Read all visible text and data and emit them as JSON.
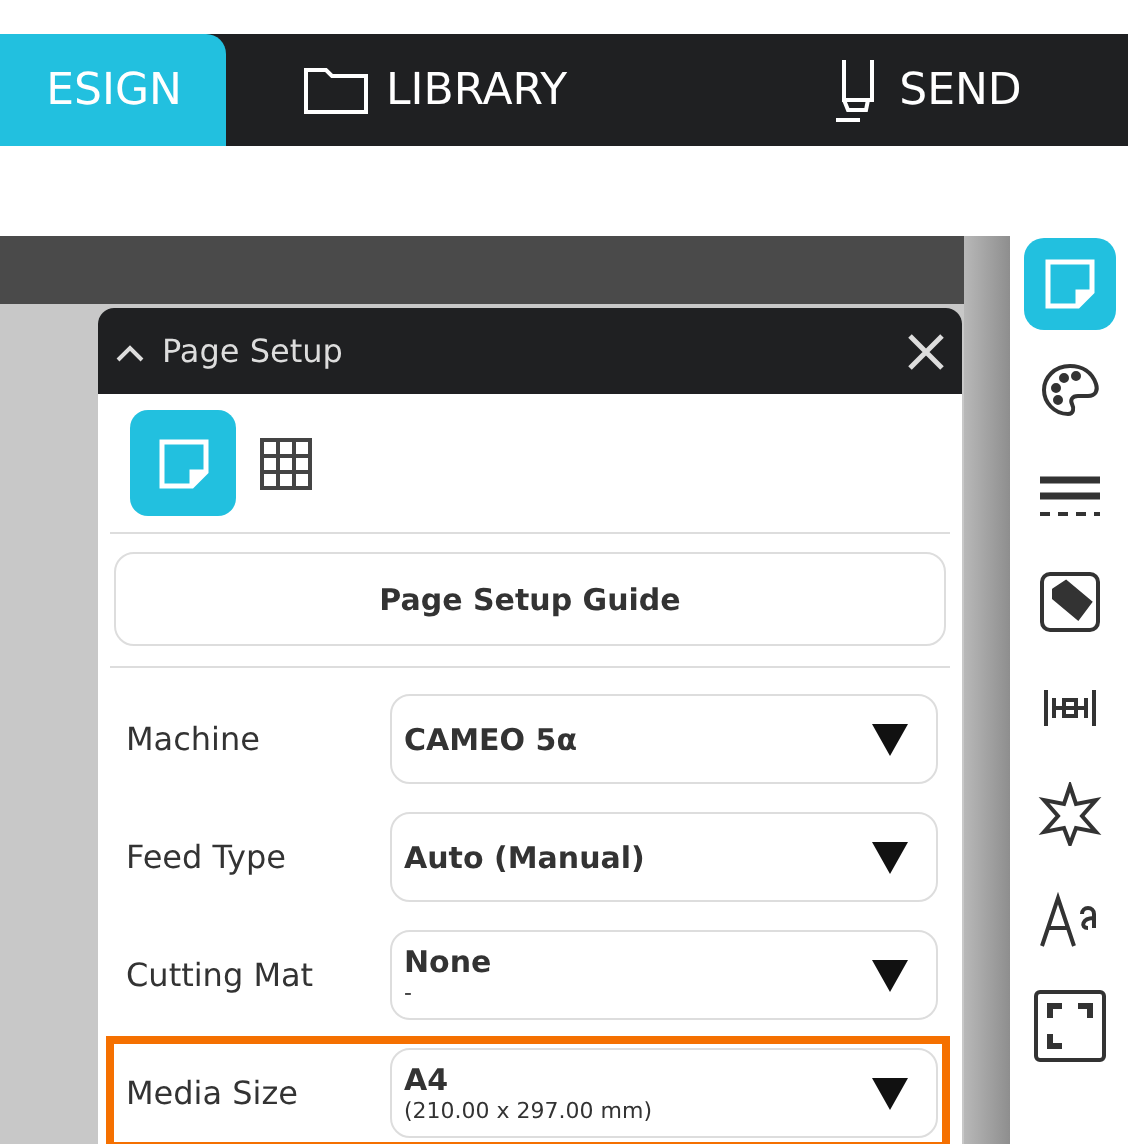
{
  "nav_tabs": [
    {
      "label": "ESIGN",
      "kind": "design",
      "selected": true
    },
    {
      "label": "LIBRARY",
      "kind": "library",
      "selected": false
    },
    {
      "label": "SEND",
      "kind": "send",
      "selected": false
    }
  ],
  "panel": {
    "title": "Page Setup",
    "tabs": [
      {
        "kind": "page",
        "selected": true
      },
      {
        "kind": "grid",
        "selected": false
      }
    ],
    "guide_button": "Page Setup Guide",
    "fields": [
      {
        "label": "Machine",
        "value": "CAMEO 5α",
        "highlighted": false
      },
      {
        "label": "Feed Type",
        "value": "Auto (Manual)",
        "highlighted": false
      },
      {
        "label": "Cutting Mat",
        "value": "None",
        "detail": "-",
        "highlighted": false
      },
      {
        "label": "Media Size",
        "value": "A4",
        "detail": "(210.00 x 297.00 mm)",
        "highlighted": true
      }
    ]
  },
  "toolbar": [
    {
      "kind": "page",
      "selected": true
    },
    {
      "kind": "palette",
      "selected": false
    },
    {
      "kind": "lines",
      "selected": false
    },
    {
      "kind": "fill",
      "selected": false
    },
    {
      "kind": "offset",
      "selected": false
    },
    {
      "kind": "star",
      "selected": false
    },
    {
      "kind": "text",
      "selected": false
    },
    {
      "kind": "frame",
      "selected": false
    }
  ]
}
